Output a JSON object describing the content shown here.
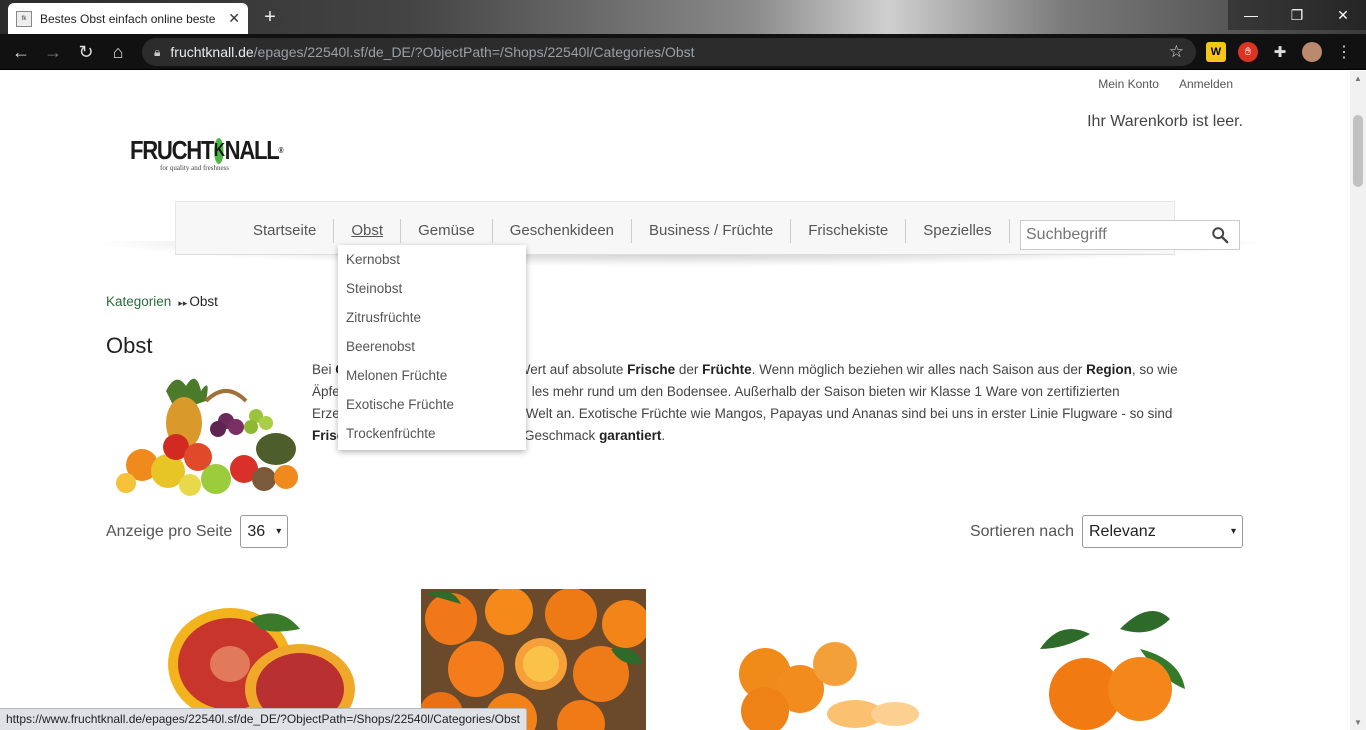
{
  "browser": {
    "tab_title": "Bestes Obst einfach online beste",
    "tab_close": "✕",
    "new_tab": "+",
    "url_domain": "fruchtknall.de",
    "url_path": "/epages/22540l.sf/de_DE/?ObjectPath=/Shops/22540l/Categories/Obst",
    "window_min": "—",
    "window_max": "❐",
    "window_close": "✕"
  },
  "header": {
    "my_account": "Mein Konto",
    "login": "Anmelden",
    "cart_status": "Ihr Warenkorb ist leer.",
    "logo_left": "FRUCHT",
    "logo_k": "K",
    "logo_right": "NALL",
    "logo_tagline": "for quality and freshness"
  },
  "nav": {
    "items": [
      "Startseite",
      "Obst",
      "Gemüse",
      "Geschenkideen",
      "Business / Früchte",
      "Frischekiste",
      "Spezielles"
    ],
    "search_placeholder": "Suchbegriff"
  },
  "dropdown": {
    "items": [
      "Kernobst",
      "Steinobst",
      "Zitrusfrüchte",
      "Beerenobst",
      "Melonen Früchte",
      "Exotische Früchte",
      "Trockenfrüchte"
    ]
  },
  "breadcrumb": {
    "root": "Kategorien",
    "current": "Obst"
  },
  "category": {
    "title": "Obst",
    "desc_l1a": "Bei ",
    "desc_l1b": "en Wert auf absolute ",
    "desc_l1_bold1": "Frische",
    "desc_l1c": " der ",
    "desc_l1_bold2": "Früchte",
    "desc_l1d": ". Wenn möglich beziehen wir alles nach Saison aus der ",
    "desc_l1_bold3": "Region",
    "desc_l1e": ", so wie",
    "desc_l2a": "Äpfe",
    "desc_l2b": "les mehr rund um den Bodensee. Außerhalb der Saison bieten wir Klasse 1 Ware von zertifizierten",
    "desc_l3a": "Erze",
    "desc_l3b": "Welt an. Exotische Früchte wie Mangos, Papayas und Ananas sind bei uns in erster Linie Flugware - so sind",
    "desc_l4a": "Frisc",
    "desc_l4b": " Geschmack ",
    "desc_l4_bold": "garantiert",
    "desc_l4c": "."
  },
  "listing": {
    "per_page_label": "Anzeige pro Seite",
    "per_page_value": "36",
    "sort_label": "Sortieren nach",
    "sort_value": "Relevanz"
  },
  "status_url": "https://www.fruchtknall.de/epages/22540l.sf/de_DE/?ObjectPath=/Shops/22540l/Categories/Obst"
}
